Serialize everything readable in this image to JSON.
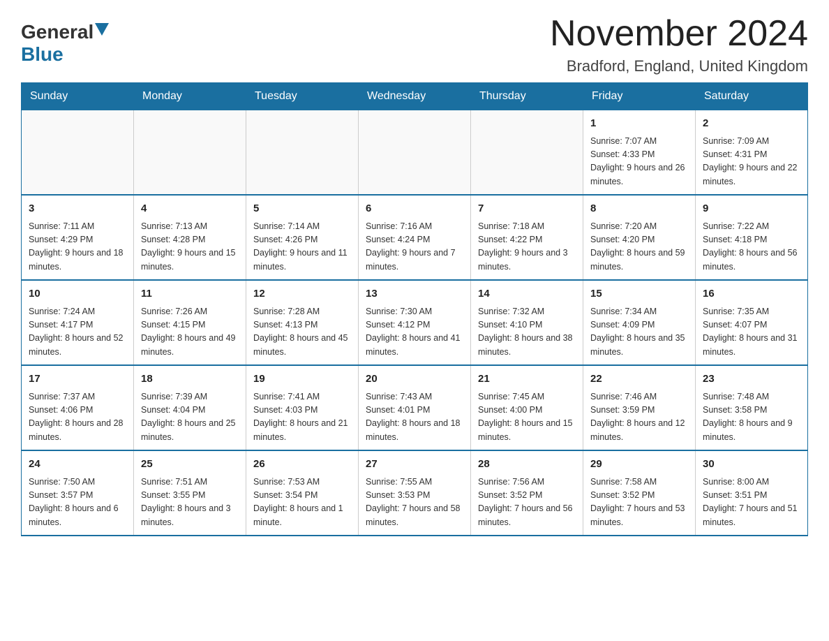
{
  "logo": {
    "general": "General",
    "blue": "Blue"
  },
  "title": "November 2024",
  "location": "Bradford, England, United Kingdom",
  "weekdays": [
    "Sunday",
    "Monday",
    "Tuesday",
    "Wednesday",
    "Thursday",
    "Friday",
    "Saturday"
  ],
  "weeks": [
    [
      {
        "day": "",
        "info": ""
      },
      {
        "day": "",
        "info": ""
      },
      {
        "day": "",
        "info": ""
      },
      {
        "day": "",
        "info": ""
      },
      {
        "day": "",
        "info": ""
      },
      {
        "day": "1",
        "info": "Sunrise: 7:07 AM\nSunset: 4:33 PM\nDaylight: 9 hours\nand 26 minutes."
      },
      {
        "day": "2",
        "info": "Sunrise: 7:09 AM\nSunset: 4:31 PM\nDaylight: 9 hours\nand 22 minutes."
      }
    ],
    [
      {
        "day": "3",
        "info": "Sunrise: 7:11 AM\nSunset: 4:29 PM\nDaylight: 9 hours\nand 18 minutes."
      },
      {
        "day": "4",
        "info": "Sunrise: 7:13 AM\nSunset: 4:28 PM\nDaylight: 9 hours\nand 15 minutes."
      },
      {
        "day": "5",
        "info": "Sunrise: 7:14 AM\nSunset: 4:26 PM\nDaylight: 9 hours\nand 11 minutes."
      },
      {
        "day": "6",
        "info": "Sunrise: 7:16 AM\nSunset: 4:24 PM\nDaylight: 9 hours\nand 7 minutes."
      },
      {
        "day": "7",
        "info": "Sunrise: 7:18 AM\nSunset: 4:22 PM\nDaylight: 9 hours\nand 3 minutes."
      },
      {
        "day": "8",
        "info": "Sunrise: 7:20 AM\nSunset: 4:20 PM\nDaylight: 8 hours\nand 59 minutes."
      },
      {
        "day": "9",
        "info": "Sunrise: 7:22 AM\nSunset: 4:18 PM\nDaylight: 8 hours\nand 56 minutes."
      }
    ],
    [
      {
        "day": "10",
        "info": "Sunrise: 7:24 AM\nSunset: 4:17 PM\nDaylight: 8 hours\nand 52 minutes."
      },
      {
        "day": "11",
        "info": "Sunrise: 7:26 AM\nSunset: 4:15 PM\nDaylight: 8 hours\nand 49 minutes."
      },
      {
        "day": "12",
        "info": "Sunrise: 7:28 AM\nSunset: 4:13 PM\nDaylight: 8 hours\nand 45 minutes."
      },
      {
        "day": "13",
        "info": "Sunrise: 7:30 AM\nSunset: 4:12 PM\nDaylight: 8 hours\nand 41 minutes."
      },
      {
        "day": "14",
        "info": "Sunrise: 7:32 AM\nSunset: 4:10 PM\nDaylight: 8 hours\nand 38 minutes."
      },
      {
        "day": "15",
        "info": "Sunrise: 7:34 AM\nSunset: 4:09 PM\nDaylight: 8 hours\nand 35 minutes."
      },
      {
        "day": "16",
        "info": "Sunrise: 7:35 AM\nSunset: 4:07 PM\nDaylight: 8 hours\nand 31 minutes."
      }
    ],
    [
      {
        "day": "17",
        "info": "Sunrise: 7:37 AM\nSunset: 4:06 PM\nDaylight: 8 hours\nand 28 minutes."
      },
      {
        "day": "18",
        "info": "Sunrise: 7:39 AM\nSunset: 4:04 PM\nDaylight: 8 hours\nand 25 minutes."
      },
      {
        "day": "19",
        "info": "Sunrise: 7:41 AM\nSunset: 4:03 PM\nDaylight: 8 hours\nand 21 minutes."
      },
      {
        "day": "20",
        "info": "Sunrise: 7:43 AM\nSunset: 4:01 PM\nDaylight: 8 hours\nand 18 minutes."
      },
      {
        "day": "21",
        "info": "Sunrise: 7:45 AM\nSunset: 4:00 PM\nDaylight: 8 hours\nand 15 minutes."
      },
      {
        "day": "22",
        "info": "Sunrise: 7:46 AM\nSunset: 3:59 PM\nDaylight: 8 hours\nand 12 minutes."
      },
      {
        "day": "23",
        "info": "Sunrise: 7:48 AM\nSunset: 3:58 PM\nDaylight: 8 hours\nand 9 minutes."
      }
    ],
    [
      {
        "day": "24",
        "info": "Sunrise: 7:50 AM\nSunset: 3:57 PM\nDaylight: 8 hours\nand 6 minutes."
      },
      {
        "day": "25",
        "info": "Sunrise: 7:51 AM\nSunset: 3:55 PM\nDaylight: 8 hours\nand 3 minutes."
      },
      {
        "day": "26",
        "info": "Sunrise: 7:53 AM\nSunset: 3:54 PM\nDaylight: 8 hours\nand 1 minute."
      },
      {
        "day": "27",
        "info": "Sunrise: 7:55 AM\nSunset: 3:53 PM\nDaylight: 7 hours\nand 58 minutes."
      },
      {
        "day": "28",
        "info": "Sunrise: 7:56 AM\nSunset: 3:52 PM\nDaylight: 7 hours\nand 56 minutes."
      },
      {
        "day": "29",
        "info": "Sunrise: 7:58 AM\nSunset: 3:52 PM\nDaylight: 7 hours\nand 53 minutes."
      },
      {
        "day": "30",
        "info": "Sunrise: 8:00 AM\nSunset: 3:51 PM\nDaylight: 7 hours\nand 51 minutes."
      }
    ]
  ]
}
